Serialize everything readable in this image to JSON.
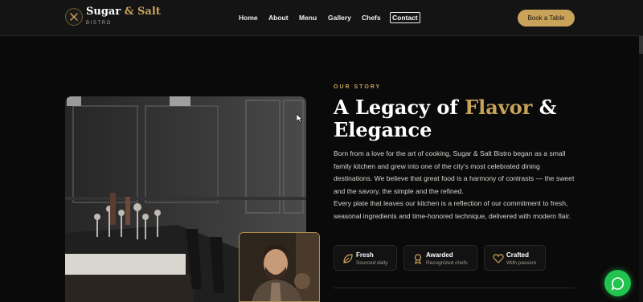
{
  "brand": {
    "name_part1": "Sugar",
    "amp": "&",
    "name_part2": "Salt",
    "subtitle": "BISTRO"
  },
  "nav": {
    "items": [
      "Home",
      "About",
      "Menu",
      "Gallery",
      "Chefs"
    ],
    "contact": "Contact",
    "cta": "Book a Table"
  },
  "story": {
    "eyebrow": "OUR STORY",
    "title_part1": "A Legacy of",
    "title_highlight": "Flavor",
    "title_part2": "& Elegance",
    "paragraph1": "Born from a love for the art of cooking, Sugar & Salt Bistro began as a small family kitchen and grew into one of the city's most celebrated dining destinations. We believe that great food is a harmony of contrasts — the sweet and the savory, the simple and the refined.",
    "paragraph2": "Every plate that leaves our kitchen is a reflection of our commitment to fresh, seasonal ingredients and time-honored technique, delivered with modern flair."
  },
  "features": [
    {
      "title": "Fresh",
      "subtitle": "Sourced daily",
      "icon": "leaf-icon"
    },
    {
      "title": "Awarded",
      "subtitle": "Recognized chefs",
      "icon": "award-icon"
    },
    {
      "title": "Crafted",
      "subtitle": "With passion",
      "icon": "heart-icon"
    }
  ],
  "colors": {
    "accent": "#c9a35a",
    "background": "#0b0a0a",
    "chat": "#22c34f"
  }
}
